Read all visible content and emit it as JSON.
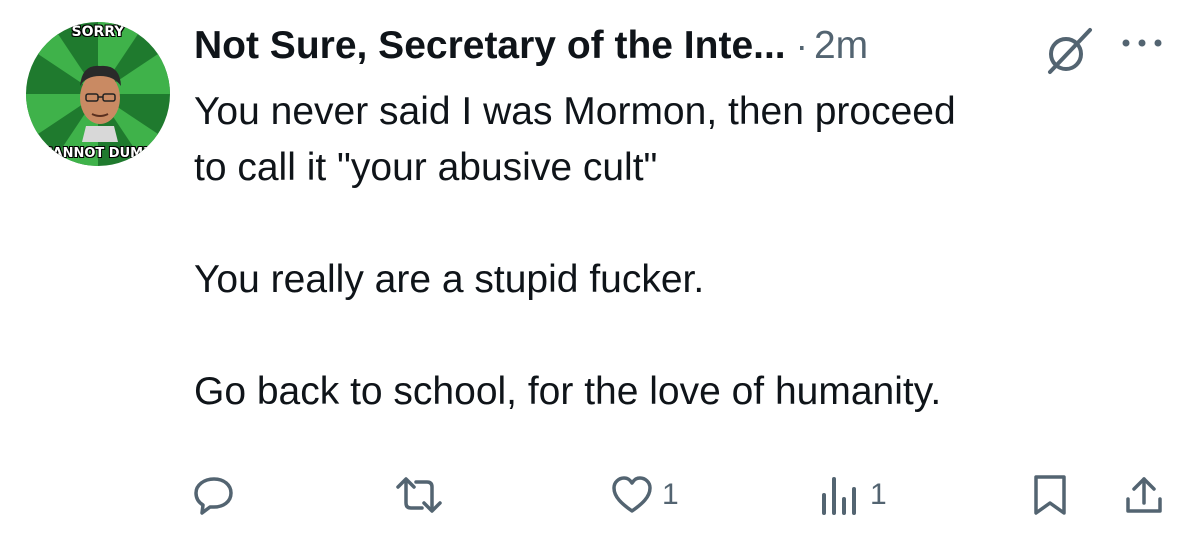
{
  "avatar": {
    "top_text": "SORRY",
    "bottom_text": "CANNOT DUMB",
    "colors": {
      "green_dark": "#1f7a2e",
      "green_light": "#3fb24a"
    }
  },
  "header": {
    "display_name": "Not Sure, Secretary of the Inte...",
    "separator": "·",
    "time": "2m",
    "grok_icon": "grok-icon",
    "more_icon": "more-dots-icon"
  },
  "tweet": {
    "line1": "You never said I was Mormon, then proceed\nto call it \"your abusive cult\"",
    "line2": "You really are a stupid fucker.",
    "line3": "Go back to school, for the love of humanity."
  },
  "actions": {
    "reply": {
      "icon": "reply-icon",
      "count": ""
    },
    "retweet": {
      "icon": "retweet-icon",
      "count": ""
    },
    "like": {
      "icon": "heart-icon",
      "count": "1"
    },
    "views": {
      "icon": "views-icon",
      "count": "1"
    },
    "bookmark": {
      "icon": "bookmark-icon",
      "count": ""
    },
    "share": {
      "icon": "share-icon",
      "count": ""
    }
  },
  "colors": {
    "text_primary": "#0f1419",
    "text_secondary": "#536471"
  }
}
